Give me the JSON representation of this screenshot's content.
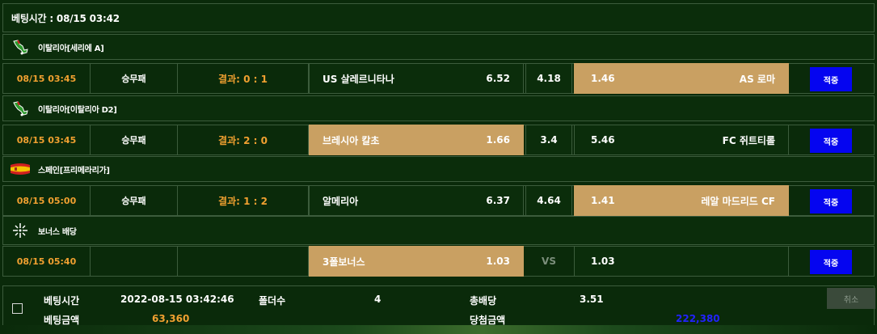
{
  "header": {
    "title": "베팅시간 : 08/15 03:42"
  },
  "colors": {
    "background": "#0a2a0a",
    "accent_orange": "#f0a030",
    "selected_odd": "#c9a062",
    "button_blue": "#0505f0",
    "payout_blue": "#2222ff"
  },
  "matches": [
    {
      "league": "이탈리아[세리에 A]",
      "flag_icon": "italy-flag-icon",
      "time": "08/15 03:45",
      "type": "승무패",
      "result": "결과: 0 : 1",
      "home": "US 살레르니타나",
      "home_odd": "6.52",
      "draw": "4.18",
      "away_odd": "1.46",
      "away": "AS 로마",
      "selected": "away",
      "button": "적중"
    },
    {
      "league": "이탈리아[이탈리아 D2]",
      "flag_icon": "italy-flag-icon",
      "time": "08/15 03:45",
      "type": "승무패",
      "result": "결과: 2 : 0",
      "home": "브레시아 칼초",
      "home_odd": "1.66",
      "draw": "3.4",
      "away_odd": "5.46",
      "away": "FC 쥐트티롤",
      "selected": "home",
      "button": "적중"
    },
    {
      "league": "스페인[프리메라리가]",
      "flag_icon": "spain-flag-icon",
      "time": "08/15 05:00",
      "type": "승무패",
      "result": "결과: 1 : 2",
      "home": "알메리아",
      "home_odd": "6.37",
      "draw": "4.64",
      "away_odd": "1.41",
      "away": "레알 마드리드 CF",
      "selected": "away",
      "button": "적중"
    },
    {
      "league": "보너스 배당",
      "flag_icon": "bonus-sparkle-icon",
      "time": "08/15 05:40",
      "type": "",
      "result": "",
      "home": "3폴보너스",
      "home_odd": "1.03",
      "draw": "VS",
      "away_odd": "1.03",
      "away": "",
      "selected": "home",
      "button": "적중"
    }
  ],
  "summary": {
    "bet_time_label": "베팅시간",
    "bet_time": "2022-08-15 03:42:46",
    "folders_label": "폴더수",
    "folders": "4",
    "total_odds_label": "총배당",
    "total_odds": "3.51",
    "bet_amount_label": "베팅금액",
    "bet_amount": "63,360",
    "win_amount_label": "당첨금액",
    "win_amount": "222,380",
    "cancel_label": "취소"
  }
}
